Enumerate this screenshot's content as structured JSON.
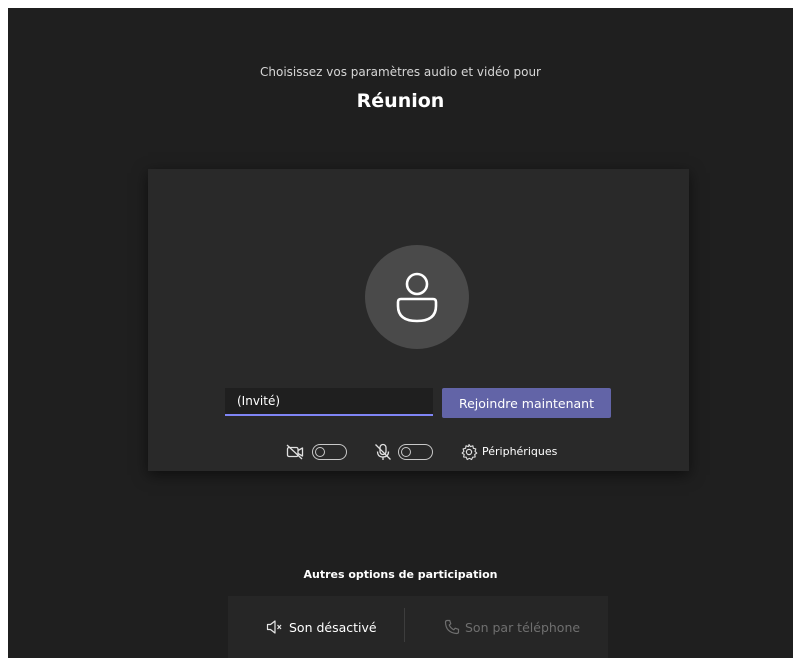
{
  "header": {
    "subtitle": "Choisissez vos paramètres audio et vidéo pour",
    "title": "Réunion"
  },
  "prejoin": {
    "name_input": {
      "value": "(Invité)",
      "placeholder": ""
    },
    "join_button_label": "Rejoindre maintenant",
    "camera_toggle": {
      "icon": "camera-off-icon",
      "on": false
    },
    "mic_toggle": {
      "icon": "mic-off-icon",
      "on": false
    },
    "devices": {
      "icon": "gear-icon",
      "label": "Périphériques"
    }
  },
  "other_options": {
    "title": "Autres options de participation",
    "items": [
      {
        "icon": "speaker-muted-icon",
        "label": "Son désactivé",
        "enabled": true
      },
      {
        "icon": "phone-icon",
        "label": "Son par téléphone",
        "enabled": false
      }
    ]
  },
  "colors": {
    "background": "#1f1f1f",
    "card": "#292929",
    "accent": "#6264a7",
    "input_underline": "#7f85f5",
    "avatar": "#4a4a4a"
  }
}
